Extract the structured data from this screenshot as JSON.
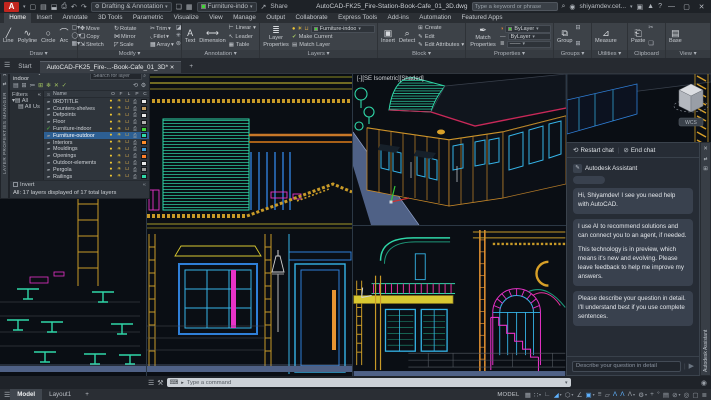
{
  "window": {
    "logo": "A",
    "workspace": "Drafting & Annotation",
    "qat_layer": "Furniture-indo",
    "share": "Share",
    "doc_title": "AutoCAD-FK25_Fire-Station-Book-Cafe_01_3D.dwg",
    "search_placeholder": "Type a keyword or phrase",
    "account": "shiyamdev.cet..."
  },
  "ribbon": {
    "tabs": [
      {
        "label": "Home",
        "active": true
      },
      {
        "label": "Insert"
      },
      {
        "label": "Annotate"
      },
      {
        "label": "3D Tools"
      },
      {
        "label": "Parametric"
      },
      {
        "label": "Visualize"
      },
      {
        "label": "View"
      },
      {
        "label": "Manage"
      },
      {
        "label": "Output"
      },
      {
        "label": "Collaborate"
      },
      {
        "label": "Express Tools"
      },
      {
        "label": "Add-ins"
      },
      {
        "label": "Automation"
      },
      {
        "label": "Featured Apps"
      }
    ],
    "draw": {
      "title": "Draw",
      "line": "Line",
      "polyline": "Polyline",
      "circle": "Circle",
      "arc": "Arc"
    },
    "modify": {
      "title": "Modify",
      "move": "Move",
      "rotate": "Rotate",
      "trim": "Trim",
      "copy": "Copy",
      "mirror": "Mirror",
      "fillet": "Fillet",
      "stretch": "Stretch",
      "scale": "Scale",
      "array": "Array"
    },
    "annotation": {
      "title": "Annotation",
      "text": "Text",
      "dimension": "Dimension",
      "linear": "Linear",
      "leader": "Leader",
      "table": "Table"
    },
    "layers": {
      "title": "Layers",
      "layer_properties": "Layer Properties",
      "current_layer": "Furniture-indoo",
      "make_current": "Make Current",
      "match_layer": "Match Layer"
    },
    "block": {
      "title": "Block",
      "insert": "Insert",
      "detect": "Detect",
      "create": "Create",
      "edit": "Edit",
      "edit_attributes": "Edit Attributes"
    },
    "properties": {
      "title": "Properties",
      "match_properties": "Match Properties",
      "bylayer_color": "ByLayer",
      "bylayer_linetype": "ByLayer"
    },
    "groups": {
      "title": "Groups",
      "group": "Group"
    },
    "utilities": {
      "title": "Utilities",
      "measure": "Measure"
    },
    "clipboard": {
      "title": "Clipboard",
      "paste": "Paste"
    },
    "view": {
      "title": "View",
      "base": "Base"
    }
  },
  "doc_tabs": {
    "start": "Start",
    "drawing": "AutoCAD-FK25_Fire-...-Book-Cafe_01_3D*"
  },
  "layer_manager": {
    "panel_title": "LAYER PROPERTIES MANAGER",
    "current_layer": "Current layer: Furniture-indoor",
    "search_placeholder": "Search for layer",
    "filters_title": "Filters",
    "filter_tree": [
      {
        "label": "All"
      },
      {
        "label": "All Us"
      }
    ],
    "columns": [
      "S",
      "Name",
      "O",
      "F",
      "L",
      "P",
      "C"
    ],
    "layers": [
      {
        "name": "0RDTITLE",
        "color": "#e8e8e8"
      },
      {
        "name": "Counters-shelves",
        "color": "#c8a060"
      },
      {
        "name": "Defpoints",
        "color": "#e8e8e8"
      },
      {
        "name": "Floor",
        "color": "#b0b0b0"
      },
      {
        "name": "Furniture-indoor",
        "color": "#3fd435",
        "current": true
      },
      {
        "name": "Furniture-outdoor",
        "color": "#2fd7a8",
        "selected": true
      },
      {
        "name": "Interiors",
        "color": "#ff8c28"
      },
      {
        "name": "Mouldings",
        "color": "#3f9bdc"
      },
      {
        "name": "Openings",
        "color": "#ff7f2a"
      },
      {
        "name": "Outdoor-elements",
        "color": "#e8e8e8"
      },
      {
        "name": "Pergola",
        "color": "#9a9a9a"
      },
      {
        "name": "Railings",
        "color": "#2fd7a8"
      }
    ],
    "invert": "Invert",
    "status": "All: 17 layers displayed of 17 total layers"
  },
  "viewports": {
    "iso_label": "[-][SE Isometric][Shaded]",
    "viewcube_label": "WCS"
  },
  "assistant": {
    "restart": "Restart chat",
    "end": "End chat",
    "title": "Autodesk Assistant",
    "vertical_tab": "Autodesk Assistant",
    "messages": [
      {
        "paragraphs": [
          "Hi, Shiyamdev! I see you need help with AutoCAD."
        ]
      },
      {
        "paragraphs": [
          "I use AI to recommend solutions and can connect you to an agent, if needed.",
          "This technology is in preview, which means it's new and evolving. Please leave feedback to help me improve my answers."
        ]
      },
      {
        "paragraphs": [
          "Please describe your question in detail. I'll understand best if you use complete sentences."
        ]
      }
    ],
    "input_placeholder": "Describe your question in detail"
  },
  "command_line": {
    "placeholder": "Type a command"
  },
  "statusbar": {
    "model": "Model",
    "layout1": "Layout1",
    "mode": "MODEL",
    "icons": [
      {
        "name": "grid-display",
        "glyph": "▦"
      },
      {
        "name": "snap-mode",
        "glyph": "∷",
        "caret": true
      },
      {
        "name": "ortho-mode",
        "glyph": "∟"
      },
      {
        "name": "polar-tracking",
        "glyph": "◢",
        "hl": true,
        "caret": true
      },
      {
        "name": "isometric-drafting",
        "glyph": "⬡",
        "caret": true
      },
      {
        "name": "osnap-tracking",
        "glyph": "∠"
      },
      {
        "name": "object-snap",
        "glyph": "▣",
        "hl": true,
        "caret": true
      },
      {
        "name": "lineweight",
        "glyph": "≡"
      },
      {
        "name": "transparency",
        "glyph": "▱"
      },
      {
        "name": "annotation-visibility",
        "glyph": "Λ",
        "hl": true
      },
      {
        "name": "auto-annotation-scale",
        "glyph": "Λ",
        "hl": true
      },
      {
        "name": "annotation-scale",
        "glyph": "Λ",
        "caret": true
      },
      {
        "name": "workspace-switching",
        "glyph": "⚙",
        "caret": true
      },
      {
        "name": "annotation-monitor",
        "glyph": "+"
      },
      {
        "name": "units",
        "glyph": "°"
      },
      {
        "name": "quick-properties",
        "glyph": "▤"
      },
      {
        "name": "lock-ui",
        "glyph": "⊘",
        "caret": true
      },
      {
        "name": "isolate-objects",
        "glyph": "◎"
      },
      {
        "name": "clean-screen",
        "glyph": "▢"
      },
      {
        "name": "customization",
        "glyph": "≣"
      }
    ]
  }
}
